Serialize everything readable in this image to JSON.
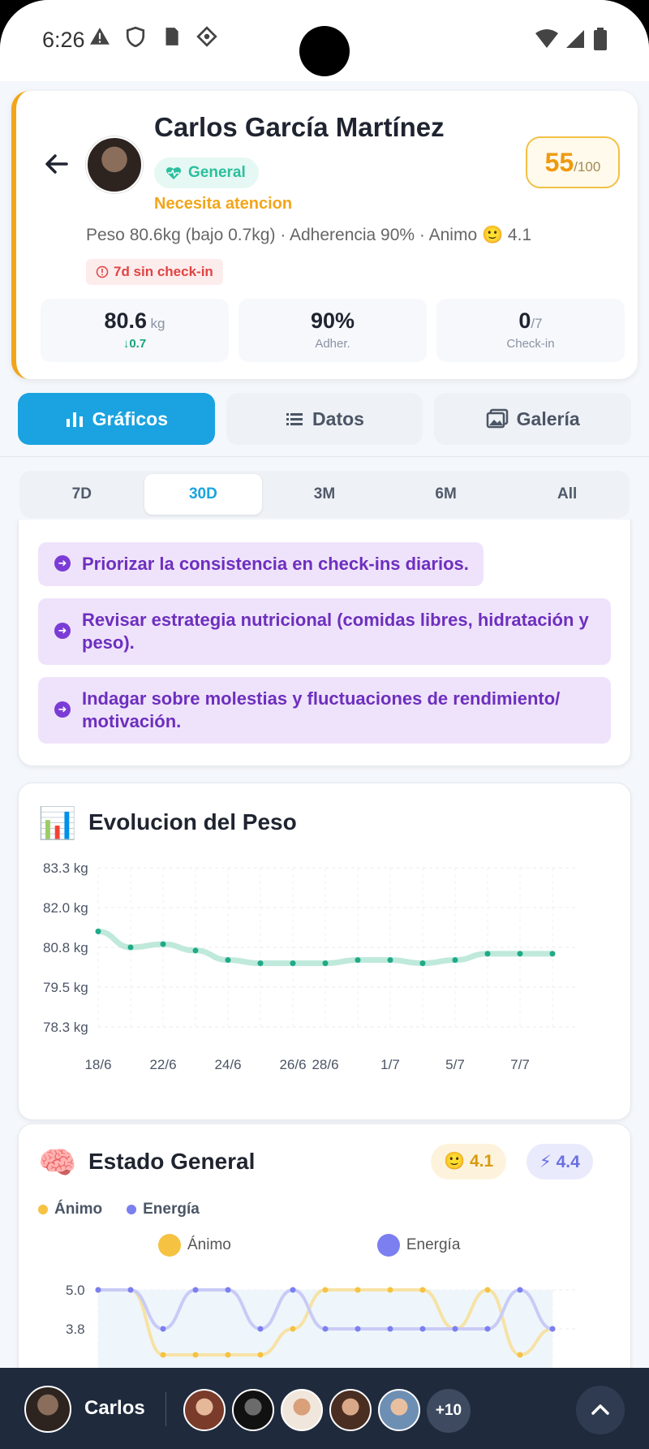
{
  "statusbar": {
    "time": "6:26"
  },
  "profile": {
    "name": "Carlos García Martínez",
    "badge": "General",
    "status": "Necesita atencion",
    "score": "55",
    "score_max": "/100",
    "summary": "Peso 80.6kg (bajo 0.7kg) · Adherencia 90% · Animo 🙂 4.1",
    "warning": "7d sin check-in",
    "stats": [
      {
        "value": "80.6",
        "unit": "kg",
        "sub": "↓0.7"
      },
      {
        "value": "90%",
        "unit": "",
        "sub": "Adher."
      },
      {
        "value": "0",
        "unit": "/7",
        "sub": "Check-in"
      }
    ]
  },
  "tabs": [
    {
      "label": "Gráficos",
      "icon": "bar-chart-icon"
    },
    {
      "label": "Datos",
      "icon": "list-icon"
    },
    {
      "label": "Galería",
      "icon": "gallery-icon"
    }
  ],
  "ranges": [
    "7D",
    "30D",
    "3M",
    "6M",
    "All"
  ],
  "recommendations": [
    "Priorizar la consistencia en check-ins diarios.",
    "Revisar estrategia nutricional (comidas libres, hidratación y peso).",
    "Indagar sobre molestias y fluctuaciones de rendimiento/ motivación."
  ],
  "weight_card": {
    "title": "Evolucion del Peso",
    "icon": "📊"
  },
  "mood_card": {
    "title": "Estado General",
    "icon": "🧠",
    "mood_pill": "🙂 4.1",
    "energy_pill": "⚡ 4.4",
    "legend_top": [
      "Ánimo",
      "Energía"
    ],
    "legend_chart": [
      "Ánimo",
      "Energía"
    ]
  },
  "colors": {
    "accent": "#1aa3e0",
    "weight_line": "#2bbf9e",
    "mood": "#f5c242",
    "energy": "#7b7ff0"
  },
  "chart_data": [
    {
      "type": "line",
      "title": "Evolucion del Peso",
      "x": [
        "18/6",
        "20/6",
        "22/6",
        "23/6",
        "24/6",
        "25/6",
        "26/6",
        "28/6",
        "29/6",
        "1/7",
        "3/7",
        "5/7",
        "6/7",
        "7/7",
        "8/7"
      ],
      "x_tick_labels": [
        "18/6",
        "22/6",
        "24/6",
        "26/6",
        "28/6",
        "1/7",
        "5/7",
        "7/7"
      ],
      "y_tick_labels": [
        "83.3 kg",
        "82.0 kg",
        "80.8 kg",
        "79.5 kg",
        "78.3 kg"
      ],
      "ylim": [
        78.3,
        83.3
      ],
      "series": [
        {
          "values": [
            81.3,
            80.8,
            80.9,
            80.7,
            80.4,
            80.3,
            80.3,
            80.3,
            80.4,
            80.4,
            80.3,
            80.4,
            80.6,
            80.6,
            80.6
          ]
        }
      ]
    },
    {
      "type": "line",
      "title": "Estado General",
      "y_tick_labels": [
        "5.0",
        "3.8"
      ],
      "ylim": [
        1.0,
        5.0
      ],
      "series": [
        {
          "name": "Ánimo",
          "values": [
            5,
            5,
            3,
            3,
            3,
            3,
            3.8,
            5,
            5,
            5,
            5,
            3.8,
            5,
            3,
            3.8
          ]
        },
        {
          "name": "Energía",
          "values": [
            5,
            5,
            3.8,
            5,
            5,
            3.8,
            5,
            3.8,
            3.8,
            3.8,
            3.8,
            3.8,
            3.8,
            5,
            3.8
          ]
        }
      ]
    }
  ],
  "bottombar": {
    "name": "Carlos",
    "more": "+10"
  }
}
